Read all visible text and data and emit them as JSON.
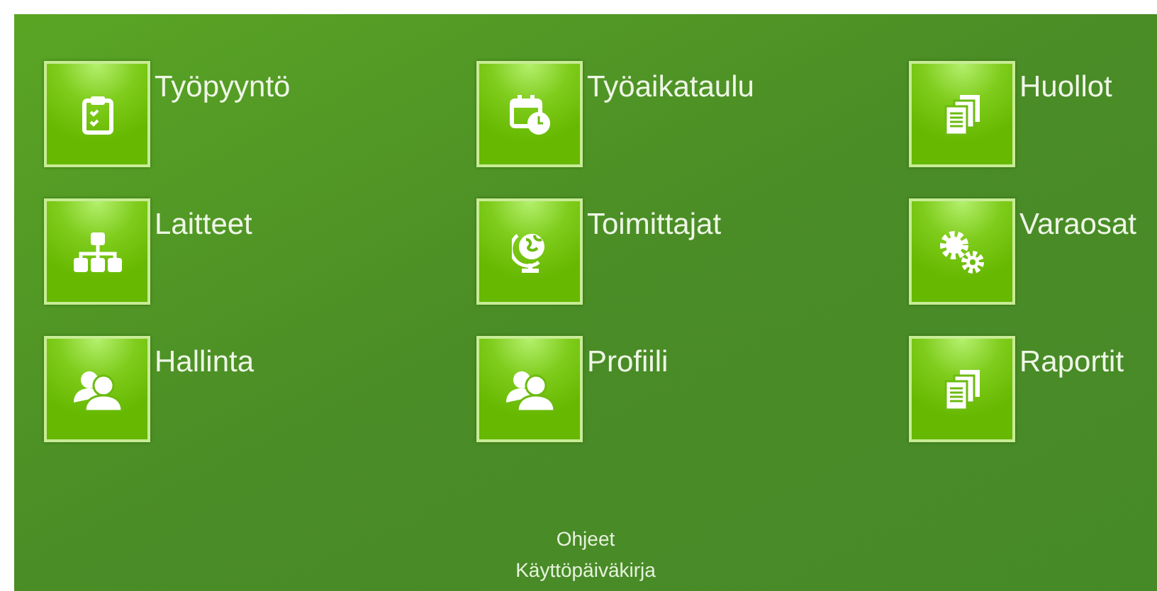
{
  "tiles": [
    {
      "label": "Työpyyntö",
      "kind": "clipboard"
    },
    {
      "label": "Työaikataulu",
      "kind": "calendar"
    },
    {
      "label": "Huollot",
      "kind": "documents"
    },
    {
      "label": "Laitteet",
      "kind": "hierarchy"
    },
    {
      "label": "Toimittajat",
      "kind": "globe"
    },
    {
      "label": "Varaosat",
      "kind": "gears"
    },
    {
      "label": "Hallinta",
      "kind": "users"
    },
    {
      "label": "Profiili",
      "kind": "users"
    },
    {
      "label": "Raportit",
      "kind": "documents"
    }
  ],
  "footer_links": [
    "Ohjeet",
    "Käyttöpäiväkirja"
  ]
}
